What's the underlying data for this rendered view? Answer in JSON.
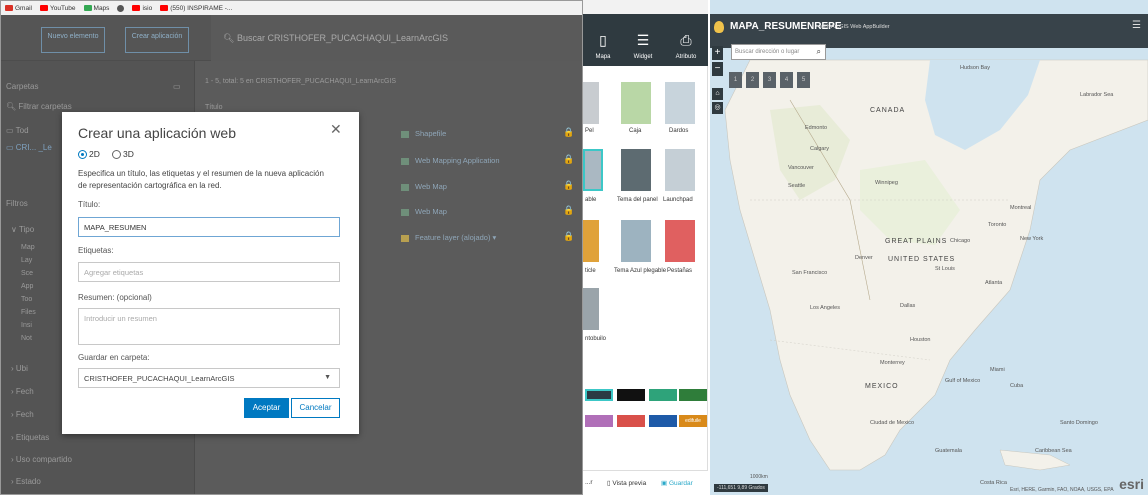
{
  "bookmarks": [
    "Gmail",
    "YouTube",
    "Maps",
    "",
    "isio",
    "(550) INSPIRAME -..."
  ],
  "bookmark_colors": [
    "#d93025",
    "#ff0000",
    "#34a853",
    "#555555",
    "#ff0000",
    "#ff0000"
  ],
  "portal": {
    "new_item_label": "Nuevo elemento",
    "create_app_label": "Crear aplicación",
    "search_placeholder": "Buscar CRISTHOFER_PUCACHAQUI_LearnArcGIS",
    "folders_heading": "Carpetas",
    "filter_folders_placeholder": "Filtrar carpetas",
    "folder_all": "Tod",
    "folder_user": "CRI... _Le",
    "filters_heading": "Filtros",
    "filter_type": "Tipo",
    "type_items": [
      "Map",
      "Lay",
      "Sce",
      "App",
      "Too",
      "Files",
      "Insi",
      "Not"
    ],
    "filter_sections": [
      "Ubi",
      "Fech",
      "Fech",
      "Etiquetas",
      "Uso compartido",
      "Estado"
    ],
    "results_summary": "1 - 5, total: 5 en CRISTHOFER_PUCACHAQUI_LearnArcGIS",
    "title_col": "Título",
    "items": [
      {
        "type": "Shapefile",
        "lock": "🔒"
      },
      {
        "type": "Web Mapping Application",
        "lock": "🔒"
      },
      {
        "type": "Web Map",
        "lock": "🔒"
      },
      {
        "type": "Web Map",
        "lock": "🔒"
      },
      {
        "type": "Feature layer (alojado) ▾",
        "lock": "🔒"
      }
    ]
  },
  "modal": {
    "title": "Crear una aplicación web",
    "close": "✕",
    "radio_2d": "2D",
    "radio_3d": "3D",
    "description": "Especifica un título, las etiquetas y el resumen de la nueva aplicación de representación cartográfica en la red.",
    "title_label": "Título:",
    "title_value": "MAPA_RESUMEN",
    "tags_label": "Etiquetas:",
    "tags_placeholder": "Agregar etiquetas",
    "summary_label": "Resumen: (opcional)",
    "summary_placeholder": "Introducir un resumen",
    "folder_label": "Guardar en carpeta:",
    "folder_value": "CRISTHOFER_PUCACHAQUI_LearnArcGIS",
    "accept": "Aceptar",
    "cancel": "Cancelar"
  },
  "builder": {
    "tabs": [
      {
        "icon": "▯",
        "label": "Mapa"
      },
      {
        "icon": "☰",
        "label": "Widget"
      },
      {
        "icon": "⎙",
        "label": "Atributo"
      }
    ],
    "themes": [
      {
        "label": "Pel",
        "color": "#c8ccd0"
      },
      {
        "label": "Caja",
        "color": "#b9d7a6"
      },
      {
        "label": "Dardos",
        "color": "#c8d4dc"
      },
      {
        "label": "able",
        "color": "#aab8c2"
      },
      {
        "label": "Tema del panel",
        "color": "#5d6b71"
      },
      {
        "label": "Launchpad",
        "color": "#c5cfd6"
      },
      {
        "label": "ticle",
        "color": "#e0a23a"
      },
      {
        "label": "Tema Azul plegable",
        "color": "#9db3c0"
      },
      {
        "label": "Pestañas",
        "color": "#e06060"
      },
      {
        "label": "ntobuilo",
        "color": "#9aa4aa"
      }
    ],
    "swatches": [
      "#2b3a44",
      "#111111",
      "#2ea37a",
      "#2f7d3a",
      "#b06fb8",
      "#d9504a",
      "#1e5aa8",
      "#d98a1a"
    ],
    "swatch_custom": "edifuile",
    "footer_preview": "Vista previa",
    "footer_save": "Guardar"
  },
  "map": {
    "title": "MAPA_RESUMENREPE",
    "subtitle": "with ArcGIS Web AppBuilder",
    "search_placeholder": "Buscar dirección o lugar",
    "zoom_in": "+",
    "zoom_out": "−",
    "pages": [
      "1",
      "2",
      "3",
      "4",
      "5"
    ],
    "labels": {
      "canada": "CANADA",
      "great_plains": "GREAT PLAINS",
      "united_states": "UNITED STATES",
      "mexico": "MEXICO",
      "edmonton": "Edmonto",
      "calgary": "Calgary",
      "vancouver": "Vancouver",
      "seattle": "Seattle",
      "winnipeg": "Winnipeg",
      "chicago": "Chicago",
      "montreal": "Montreal",
      "toronto": "Toronto",
      "new_york": "New York",
      "denver": "Denver",
      "los_angeles": "Los Angeles",
      "san_francisco": "San Francisco",
      "houston": "Houston",
      "miami": "Miami",
      "cuba": "Cuba",
      "guatemala": "Guatemala",
      "mexico_city": "Ciudad de Mexico",
      "hudson": "Hudson Bay",
      "labrador": "Labrador Sea",
      "gulf": "Gulf of Mexico",
      "atlanta": "Atlanta",
      "dallas": "Dallas",
      "st_louis": "St Louis",
      "monterrey": "Monterrey",
      "dominican": "Santo Domingo",
      "caribbean": "Caribbean Sea",
      "costa_rica": "Costa Rica"
    },
    "scale": "-111,651  9,89 Grados",
    "scale_bar": "1000km",
    "attribution": "Esri, HERE, Garmin, FAO, NOAA, USGS, EPA",
    "esri": "esri"
  }
}
